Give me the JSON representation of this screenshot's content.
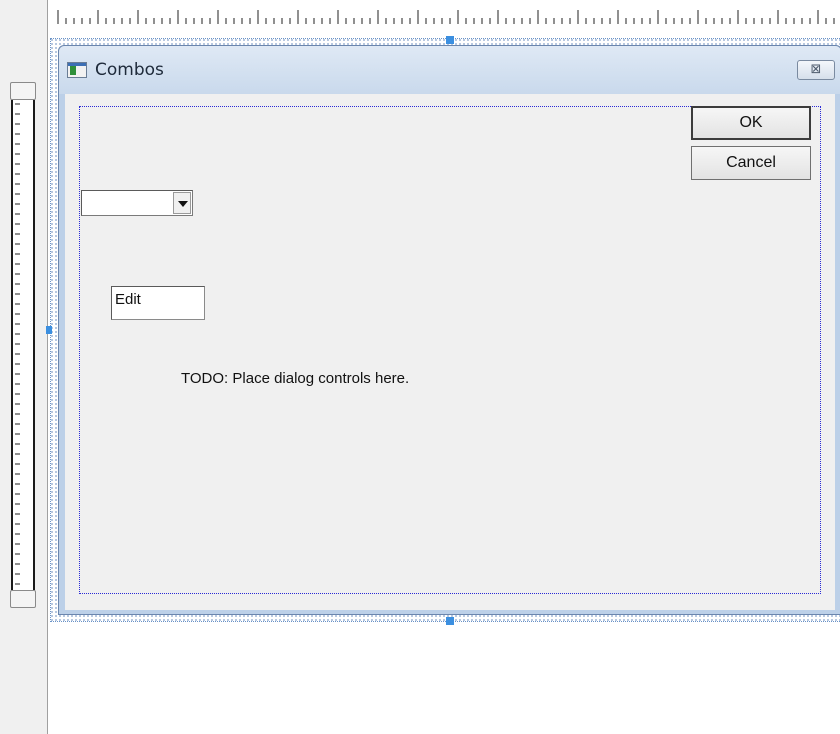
{
  "dialog": {
    "title": "Combos",
    "close_glyph": "⊠"
  },
  "controls": {
    "combo_value": "",
    "edit_text": "Edit",
    "ok_label": "OK",
    "cancel_label": "Cancel",
    "todo_text": "TODO: Place dialog controls here."
  },
  "icons": {
    "app": "dialog-app-icon",
    "close": "close-icon",
    "combo_arrow": "chevron-down-icon"
  },
  "colors": {
    "title_gradient_top": "#dfe9f5",
    "title_gradient_bottom": "#c9d9ec",
    "client_bg": "#f0f0f0",
    "guide_border": "#2b2bd6",
    "selection_handle": "#3b8fe0"
  }
}
